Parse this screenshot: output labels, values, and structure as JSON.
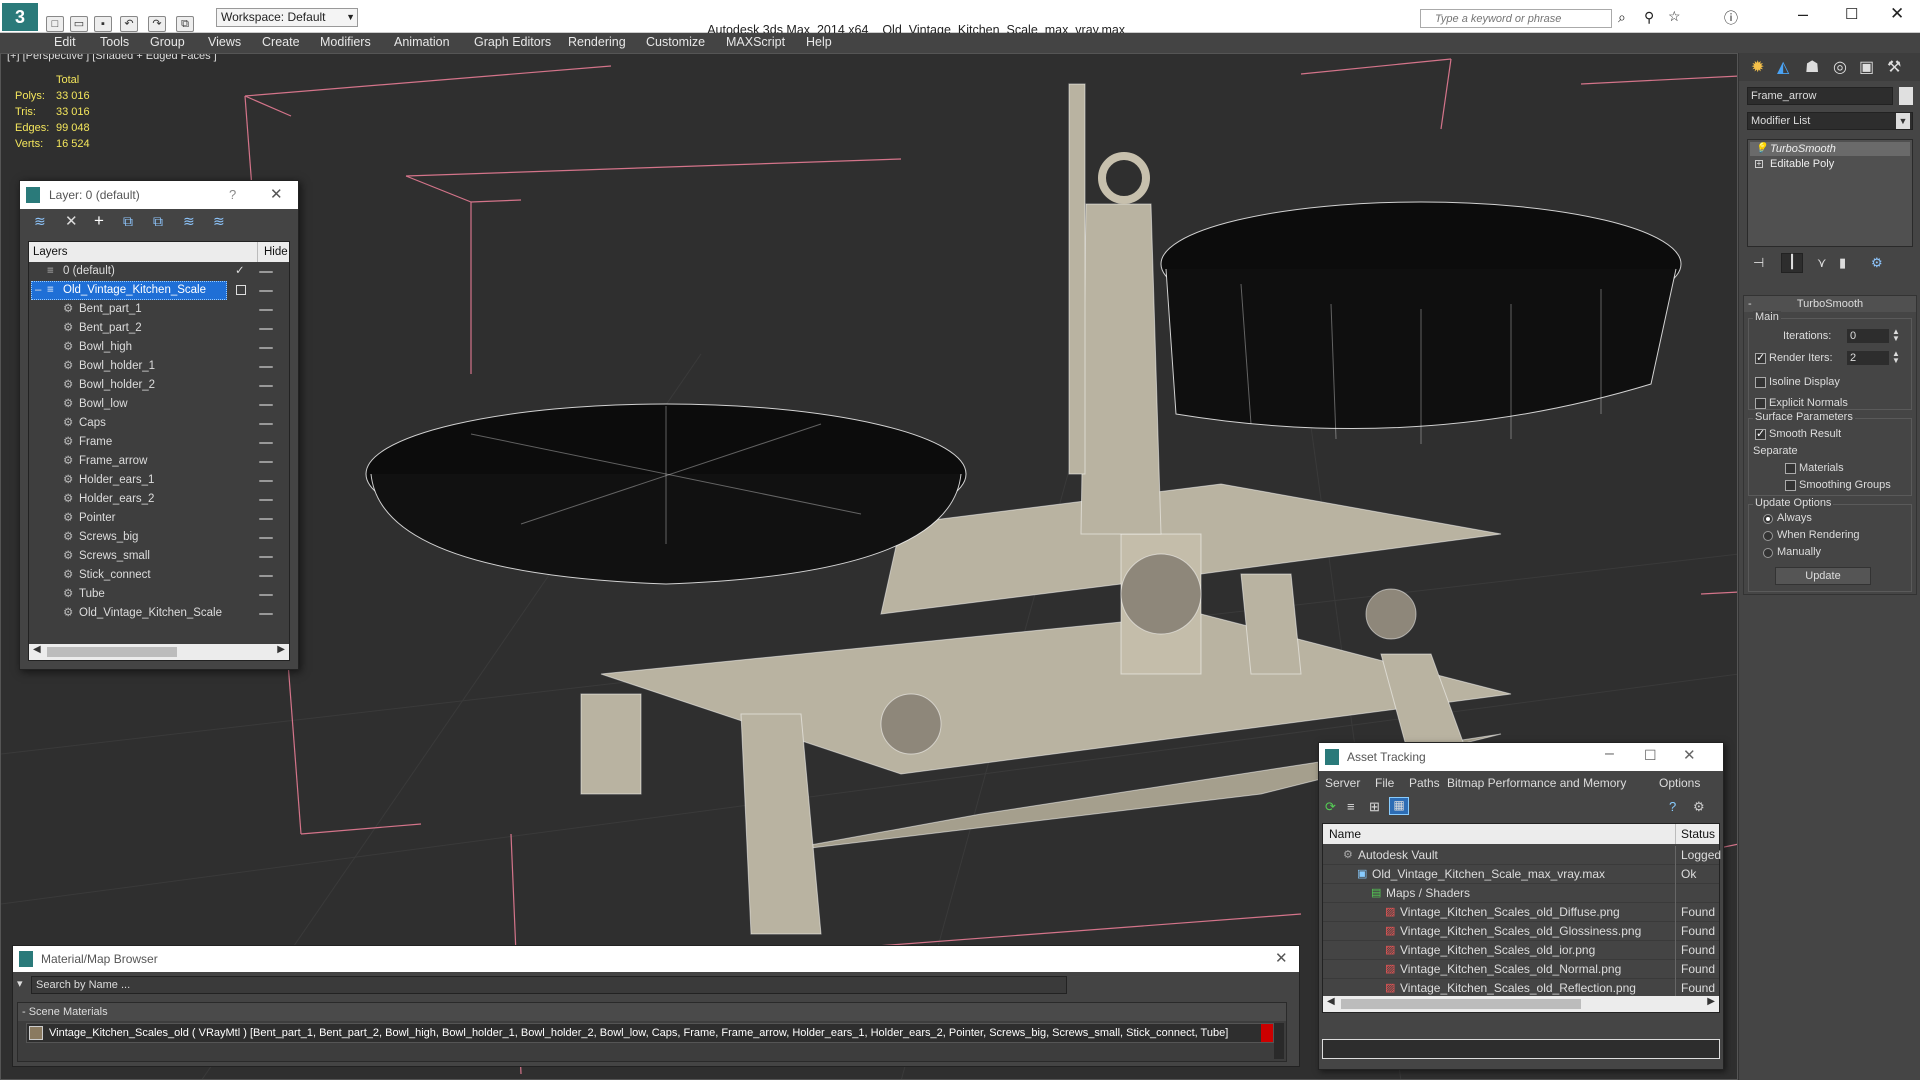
{
  "app": {
    "title": "Autodesk 3ds Max  2014 x64",
    "file": "Old_Vintage_Kitchen_Scale_max_vray.max",
    "workspace": "Workspace: Default",
    "search_placeholder": "Type a keyword or phrase"
  },
  "menu": [
    "Edit",
    "Tools",
    "Group",
    "Views",
    "Create",
    "Modifiers",
    "Animation",
    "Graph Editors",
    "Rendering",
    "Customize",
    "MAXScript",
    "Help"
  ],
  "viewport": {
    "label": "[+] [Perspective ] [Shaded + Edged Faces ]",
    "stats": {
      "total_label": "Total",
      "rows": [
        {
          "label": "Polys:",
          "value": "33 016"
        },
        {
          "label": "Tris:",
          "value": "33 016"
        },
        {
          "label": "Edges:",
          "value": "99 048"
        },
        {
          "label": "Verts:",
          "value": "16 524"
        }
      ]
    }
  },
  "layer_window": {
    "title": "Layer: 0 (default)",
    "help": "?",
    "col_layers": "Layers",
    "col_hide": "Hide",
    "default_layer": "0 (default)",
    "selected_layer": "Old_Vintage_Kitchen_Scale",
    "objects": [
      "Bent_part_1",
      "Bent_part_2",
      "Bowl_high",
      "Bowl_holder_1",
      "Bowl_holder_2",
      "Bowl_low",
      "Caps",
      "Frame",
      "Frame_arrow",
      "Holder_ears_1",
      "Holder_ears_2",
      "Pointer",
      "Screws_big",
      "Screws_small",
      "Stick_connect",
      "Tube",
      "Old_Vintage_Kitchen_Scale"
    ]
  },
  "command_panel": {
    "object_name": "Frame_arrow",
    "modifier_list": "Modifier List",
    "stack": [
      "TurboSmooth",
      "Editable Poly"
    ],
    "turbosmooth": {
      "title": "TurboSmooth",
      "main": "Main",
      "iterations_label": "Iterations:",
      "iterations": "0",
      "render_iters_label": "Render Iters:",
      "render_iters": "2",
      "isoline": "Isoline Display",
      "explicit": "Explicit Normals",
      "surface": "Surface Parameters",
      "smooth_result": "Smooth Result",
      "separate": "Separate",
      "materials": "Materials",
      "smoothing_groups": "Smoothing Groups",
      "update_options": "Update Options",
      "always": "Always",
      "when_rendering": "When Rendering",
      "manually": "Manually",
      "update": "Update"
    }
  },
  "asset_tracking": {
    "title": "Asset Tracking",
    "menu": [
      "Server",
      "File",
      "Paths",
      "Bitmap Performance and Memory",
      "Options"
    ],
    "col_name": "Name",
    "col_status": "Status",
    "rows": [
      {
        "name": "Autodesk Vault",
        "status": "Logged"
      },
      {
        "name": "Old_Vintage_Kitchen_Scale_max_vray.max",
        "status": "Ok"
      },
      {
        "name": "Maps / Shaders",
        "status": ""
      },
      {
        "name": "Vintage_Kitchen_Scales_old_Diffuse.png",
        "status": "Found"
      },
      {
        "name": "Vintage_Kitchen_Scales_old_Glossiness.png",
        "status": "Found"
      },
      {
        "name": "Vintage_Kitchen_Scales_old_ior.png",
        "status": "Found"
      },
      {
        "name": "Vintage_Kitchen_Scales_old_Normal.png",
        "status": "Found"
      },
      {
        "name": "Vintage_Kitchen_Scales_old_Reflection.png",
        "status": "Found"
      }
    ]
  },
  "material_browser": {
    "title": "Material/Map Browser",
    "search": "Search by Name ...",
    "section": "- Scene Materials",
    "material": "Vintage_Kitchen_Scales_old  ( VRayMtl ) [Bent_part_1, Bent_part_2, Bowl_high, Bowl_holder_1, Bowl_holder_2, Bowl_low, Caps, Frame, Frame_arrow, Holder_ears_1, Holder_ears_2, Pointer, Screws_big, Screws_small, Stick_connect, Tube]"
  }
}
